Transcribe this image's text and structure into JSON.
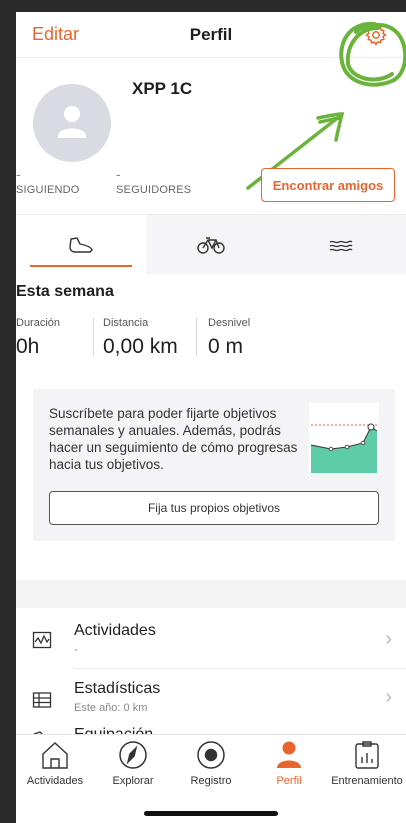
{
  "header": {
    "edit_label": "Editar",
    "title": "Perfil",
    "settings_icon": "gear-icon"
  },
  "profile": {
    "username": "XPP 1C",
    "following_value": "-",
    "following_label": "SIGUIENDO",
    "followers_value": "-",
    "followers_label": "SEGUIDORES",
    "find_friends_label": "Encontrar amigos"
  },
  "sport_tabs": [
    {
      "icon": "shoe-icon",
      "active": true
    },
    {
      "icon": "bike-icon",
      "active": false
    },
    {
      "icon": "swim-icon",
      "active": false
    }
  ],
  "week": {
    "title": "Esta semana",
    "metrics": [
      {
        "label": "Duración",
        "value": "0h"
      },
      {
        "label": "Distancia",
        "value": "0,00 km"
      },
      {
        "label": "Desnivel",
        "value": "0 m"
      }
    ]
  },
  "promo": {
    "text": "Suscríbete para poder fijarte objetivos semanales y anuales. Además, podrás hacer un seguimiento de cómo progresas hacia tus objetivos.",
    "button_label": "Fija tus propios objetivos"
  },
  "list": [
    {
      "title": "Actividades",
      "subtitle": "-",
      "icon": "activity-icon"
    },
    {
      "title": "Estadísticas",
      "subtitle": "Este año: 0 km",
      "icon": "stats-icon"
    },
    {
      "title": "Equipación",
      "subtitle": "",
      "icon": "gear-shoe-icon"
    }
  ],
  "tabbar": [
    {
      "label": "Actividades",
      "icon": "home-icon"
    },
    {
      "label": "Explorar",
      "icon": "compass-icon"
    },
    {
      "label": "Registro",
      "icon": "record-icon"
    },
    {
      "label": "Perfil",
      "icon": "person-icon",
      "active": true
    },
    {
      "label": "Entrenamiento",
      "icon": "calendar-icon"
    }
  ],
  "colors": {
    "accent": "#e8652d",
    "chart_fill": "#5fcca8",
    "annotation": "#6ab43c"
  }
}
